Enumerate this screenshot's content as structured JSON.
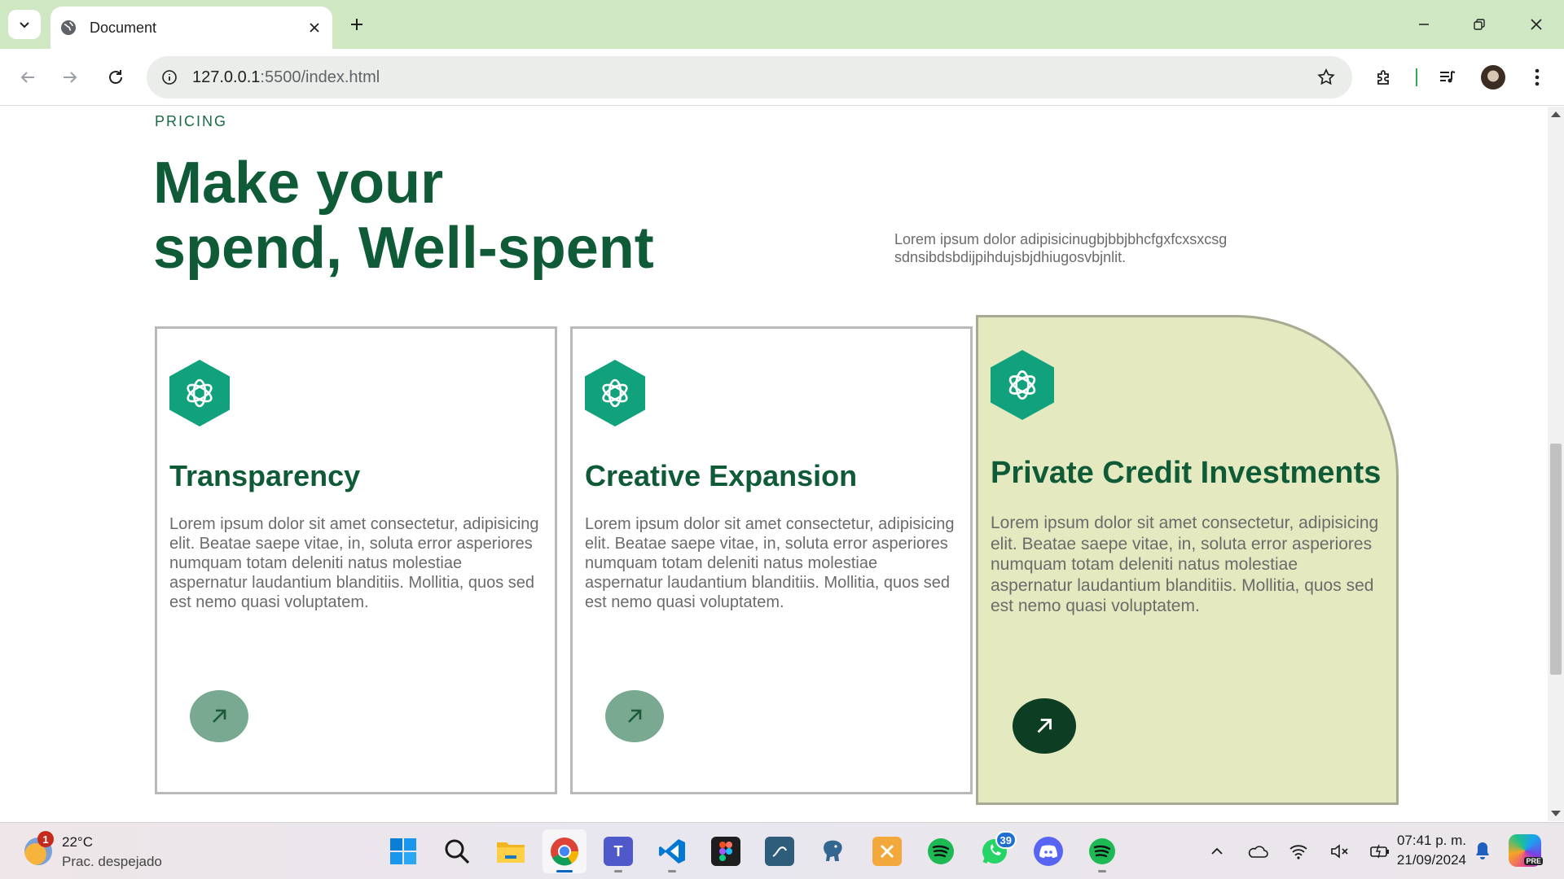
{
  "browser": {
    "tab_title": "Document",
    "url_host": "127.0.0.1",
    "url_path": ":5500/index.html"
  },
  "page": {
    "eyebrow": "PRICING",
    "headline_line1": "Make your",
    "headline_line2": "spend, Well-spent",
    "lead_line1": "Lorem ipsum dolor adipisicinugbjbbjbhcfgxfcxsxcsg",
    "lead_line2": "sdnsibdsbdijpihdujsbjdhiugosvbjnlit.",
    "cards": [
      {
        "title": "Transparency",
        "body": "Lorem ipsum dolor sit amet consectetur, adipisicing elit. Beatae saepe vitae, in, soluta error asperiores numquam totam deleniti natus molestiae aspernatur laudantium blanditiis. Mollitia, quos sed est nemo quasi voluptatem.",
        "icon": "openai-logo-icon",
        "button_icon": "arrow-up-right-icon"
      },
      {
        "title": "Creative Expansion",
        "body": "Lorem ipsum dolor sit amet consectetur, adipisicing elit. Beatae saepe vitae, in, soluta error asperiores numquam totam deleniti natus molestiae aspernatur laudantium blanditiis. Mollitia, quos sed est nemo quasi voluptatem.",
        "icon": "openai-logo-icon",
        "button_icon": "arrow-up-right-icon"
      },
      {
        "title": "Private Credit Investments",
        "body": "Lorem ipsum dolor sit amet consectetur, adipisicing elit. Beatae saepe vitae, in, soluta error asperiores numquam totam deleniti natus molestiae aspernatur laudantium blanditiis. Mollitia, quos sed est nemo quasi voluptatem.",
        "icon": "openai-logo-icon",
        "button_icon": "arrow-up-right-icon"
      }
    ]
  },
  "colors": {
    "brand_green": "#0f5a37",
    "icon_green": "#11a27d",
    "highlight_card_bg": "#e4e9bf",
    "muted_button": "#7aa991",
    "dark_button": "#0d3e24",
    "tabbar_bg": "#cfe8c3"
  },
  "taskbar": {
    "weather_temp": "22°C",
    "weather_condition": "Prac. despejado",
    "weather_badge": "1",
    "whatsapp_badge": "39",
    "time": "07:41 p. m.",
    "date": "21/09/2024",
    "copilot_label": "PRE",
    "apps": [
      "start",
      "search",
      "file-explorer",
      "chrome",
      "teams",
      "vscode",
      "figma",
      "mysql-workbench",
      "postgresql",
      "xampp",
      "spotify",
      "whatsapp",
      "discord",
      "spotify"
    ]
  }
}
